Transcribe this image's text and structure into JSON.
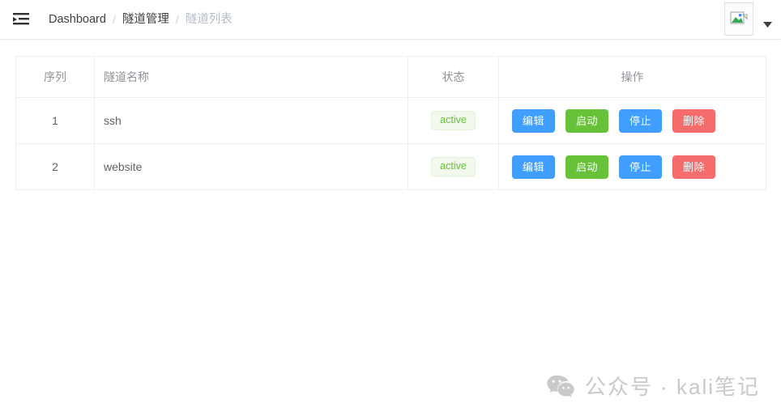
{
  "header": {
    "menu_toggle_icon": "list-indent-icon",
    "breadcrumb": {
      "items": [
        {
          "label": "Dashboard",
          "current": false
        },
        {
          "label": "隧道管理",
          "current": false
        },
        {
          "label": "隧道列表",
          "current": true
        }
      ],
      "separator": "/"
    },
    "avatar": {
      "icon": "broken-image-icon",
      "alt": ""
    },
    "dropdown_caret_icon": "caret-down-icon"
  },
  "table": {
    "columns": [
      {
        "key": "index",
        "label": "序列"
      },
      {
        "key": "name",
        "label": "隧道名称"
      },
      {
        "key": "status",
        "label": "状态"
      },
      {
        "key": "ops",
        "label": "操作"
      }
    ],
    "rows": [
      {
        "index": "1",
        "name": "ssh",
        "status": "active",
        "actions": [
          {
            "label": "编辑",
            "variant": "primary"
          },
          {
            "label": "启动",
            "variant": "success"
          },
          {
            "label": "停止",
            "variant": "primary"
          },
          {
            "label": "删除",
            "variant": "danger"
          }
        ]
      },
      {
        "index": "2",
        "name": "website",
        "status": "active",
        "actions": [
          {
            "label": "编辑",
            "variant": "primary"
          },
          {
            "label": "启动",
            "variant": "success"
          },
          {
            "label": "停止",
            "variant": "primary"
          },
          {
            "label": "删除",
            "variant": "danger"
          }
        ]
      }
    ]
  },
  "watermark": {
    "icon": "wechat-icon",
    "text": "公众号 · kali笔记"
  },
  "colors": {
    "primary": "#409EFF",
    "success": "#67C23A",
    "danger": "#F56C6C",
    "badge_bg": "#F0F9EB",
    "badge_border": "#E1F3D8",
    "badge_text": "#67C23A",
    "table_border": "#EBEEF5",
    "header_text": "#909399",
    "body_text": "#606266",
    "breadcrumb_current": "#B6BCC6",
    "watermark_text": "#C9C9C9"
  }
}
